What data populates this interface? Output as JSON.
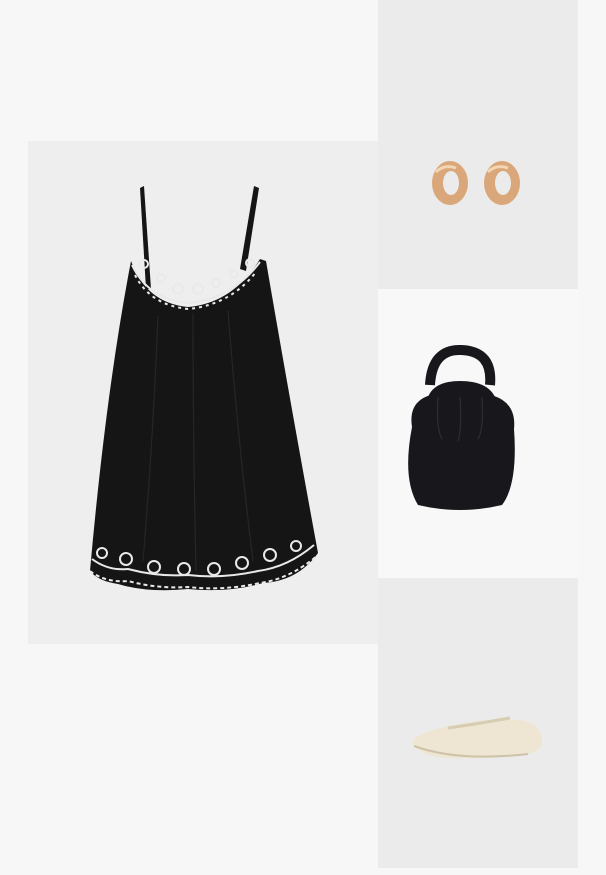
{
  "layout": "outfit-collage",
  "panels": [
    {
      "id": "dress",
      "item": "black-embroidered-slip-dress"
    },
    {
      "id": "earrings",
      "item": "gold-knot-stud-earrings"
    },
    {
      "id": "bag",
      "item": "black-gathered-top-handle-bag"
    },
    {
      "id": "shoe",
      "item": "cream-mary-jane-ballet-flat"
    }
  ],
  "colors": {
    "background": "#f7f7f7",
    "dress": "#151515",
    "embroidery": "#e9e9e9",
    "gold": "#d9a77a",
    "bag": "#17171c",
    "shoe": "#eee6d2"
  }
}
